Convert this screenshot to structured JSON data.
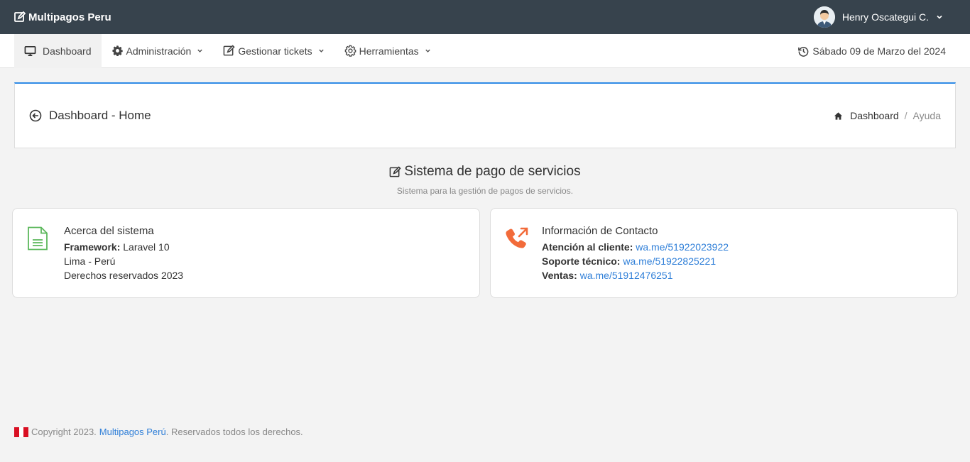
{
  "topbar": {
    "brand": "Multipagos Peru",
    "user_name": "Henry Oscategui C."
  },
  "nav": {
    "items": [
      {
        "label": "Dashboard",
        "icon": "monitor-icon"
      },
      {
        "label": "Administración",
        "icon": "gear-icon"
      },
      {
        "label": "Gestionar tickets",
        "icon": "edit-icon"
      },
      {
        "label": "Herramientas",
        "icon": "cog-outline-icon"
      }
    ],
    "date": "Sábado 09 de Marzo del 2024"
  },
  "page_header": {
    "title": "Dashboard - Home",
    "breadcrumb_home": "Dashboard",
    "breadcrumb_sep": "/",
    "breadcrumb_current": "Ayuda"
  },
  "section": {
    "title": "Sistema de pago de servicios",
    "subtitle": "Sistema para la gestión de pagos de servicios."
  },
  "about": {
    "title": "Acerca del sistema",
    "framework_label": "Framework:",
    "framework_value": " Laravel 10",
    "location": "Lima - Perú",
    "rights": "Derechos reservados 2023"
  },
  "contact": {
    "title": "Información de Contacto",
    "customer_label": "Atención al cliente:",
    "customer_link": "wa.me/51922023922",
    "support_label": "Soporte técnico:",
    "support_link": "wa.me/51922825221",
    "sales_label": "Ventas:",
    "sales_link": "wa.me/51912476251"
  },
  "footer": {
    "prefix": "Copyright 2023.",
    "link": "Multipagos Perú",
    "suffix": ". Reservados todos los derechos."
  },
  "colors": {
    "topbar": "#37434d",
    "accent_blue": "#2f8be6",
    "doc_icon_green": "#5cb85c",
    "phone_icon_orange": "#f26b3a",
    "flag_red": "#d91023"
  }
}
